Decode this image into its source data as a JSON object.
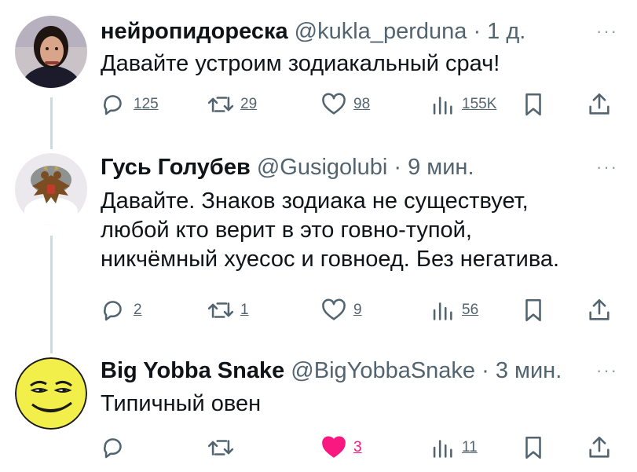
{
  "tweets": [
    {
      "name": "нейропидореска",
      "handle": "@kukla_perduna",
      "sep": "·",
      "time": "1 д.",
      "text": [
        "Давайте устроим зодиакальный срач!"
      ],
      "replies": "125",
      "retweets": "29",
      "likes": "98",
      "views": "155K",
      "liked": false
    },
    {
      "name": "Гусь Голубев",
      "handle": "@Gusigolubi",
      "sep": "·",
      "time": "9 мин.",
      "text": [
        "Давайте. Знаков зодиака не существует,",
        "любой кто верит в это говно-тупой,",
        "никчёмный хуесос и говноед. Без негатива."
      ],
      "replies": "2",
      "retweets": "1",
      "likes": "9",
      "views": "56",
      "liked": false
    },
    {
      "name": "Big Yobba Snake",
      "handle": "@BigYobbaSnake",
      "sep": "·",
      "time": "3 мин.",
      "text": [
        "Типичный овен"
      ],
      "replies": "",
      "retweets": "",
      "likes": "3",
      "views": "11",
      "liked": true
    }
  ],
  "more_label": "···",
  "icons": {
    "reply": "reply-icon",
    "retweet": "retweet-icon",
    "like": "heart-icon",
    "views": "views-icon",
    "bookmark": "bookmark-icon",
    "share": "share-icon"
  },
  "colors": {
    "text": "#0f1419",
    "secondary": "#536471",
    "thread_line": "#cfd9de",
    "like_active": "#f91880"
  }
}
